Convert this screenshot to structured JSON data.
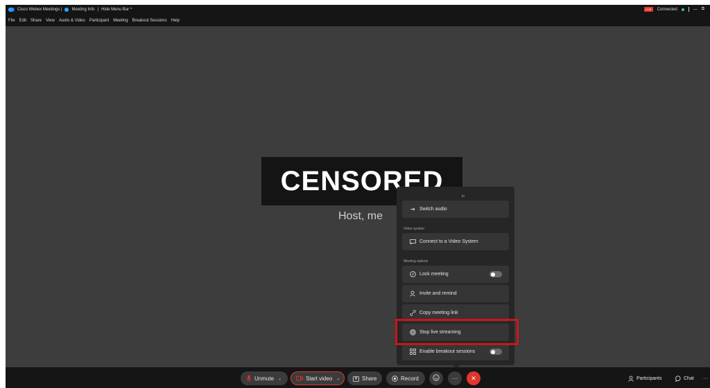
{
  "titlebar": {
    "app_title": "Cisco Webex Meetings |",
    "meeting_info": "Meeting Info",
    "separator": "|",
    "hide_menu_bar": "Hide Menu Bar ^",
    "live_badge": "LIVE",
    "connection_status": "Connected",
    "minimize": "—",
    "restore": "⧉"
  },
  "menubar": {
    "items": [
      "File",
      "Edit",
      "Share",
      "View",
      "Audio & Video",
      "Participant",
      "Meeting",
      "Breakout Sessions",
      "Help"
    ]
  },
  "stage": {
    "censor_label": "CENSORED",
    "host_name": "Host, me"
  },
  "popup": {
    "audio_label_fragment": "io",
    "switch_audio": "Switch audio",
    "video_system_label": "Video system",
    "connect_video_system": "Connect to a Video System",
    "meeting_options_label": "Meeting options",
    "lock_meeting": "Lock meeting",
    "invite_and_remind": "Invite and remind",
    "copy_meeting_link": "Copy meeting link",
    "stop_live_streaming": "Stop live streaming",
    "enable_breakout_sessions": "Enable breakout sessions",
    "lock_meeting_toggle": false,
    "breakout_toggle": false
  },
  "toolbar": {
    "unmute": "Unmute",
    "start_video": "Start video",
    "share": "Share",
    "record": "Record",
    "more": "···",
    "participants": "Participants",
    "chat": "Chat",
    "overflow": "···"
  },
  "colors": {
    "background": "#3d3d3d",
    "toolbar": "#151515",
    "popup": "#262626",
    "end_call": "#e0362c",
    "highlight": "#c8171b"
  }
}
